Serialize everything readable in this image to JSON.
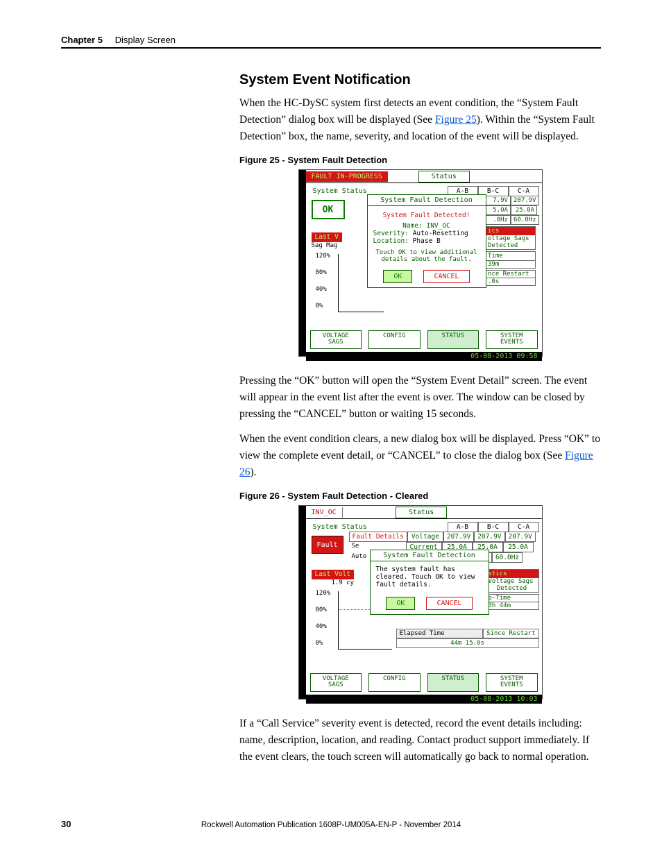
{
  "header": {
    "chapter": "Chapter 5",
    "section": "Display Screen"
  },
  "title": "System Event Notification",
  "para1_a": "When the HC-DySC system first detects an event condition, the “System Fault Detection” dialog box will be displayed (See ",
  "para1_link": "Figure 25",
  "para1_b": "). Within the “System Fault Detection” box, the name, severity, and location of the event will be displayed.",
  "fig25_cap": "Figure 25 - System Fault Detection",
  "fig25": {
    "title_tag": "FAULT IN-PROGRESS",
    "status_tab": "Status",
    "sys_status": "System Status",
    "cols": {
      "ab": "A-B",
      "bc": "B-C",
      "ca": "C-A"
    },
    "vals_ca_v": "207.9V",
    "vals_bc_v": "7.9V",
    "vals_bc_a": "5.0A",
    "vals_ca_a": "25.0A",
    "vals_bc_hz": ".0Hz",
    "vals_ca_hz": "60.0Hz",
    "ok": "OK",
    "last": "Last V",
    "sag": "Sag Mag",
    "y120": "120%",
    "y80": "80%",
    "y40": "40%",
    "y0": "0%",
    "dlg_title": "System Fault Detection",
    "dlg_detected": "System Fault Detected!",
    "dlg_name": "Name: INV_OC",
    "dlg_sev_lbl": "Severity: ",
    "dlg_sev_val": "Auto-Resetting",
    "dlg_loc_lbl": "Location: ",
    "dlg_loc_val": "Phase B",
    "dlg_hint1": "Touch OK to view additional",
    "dlg_hint2": "details about the fault.",
    "dlg_ok": "OK",
    "dlg_cancel": "CANCEL",
    "side_ics": "ics",
    "side_sags1": "oltage Sags",
    "side_sags2": "Detected",
    "side_time_h": "Time",
    "side_time_v": "39m",
    "side_restart_h": "nce Restart",
    "side_restart_v": ".0s",
    "nav_sags": "VOLTAGE\nSAGS",
    "nav_config": "CONFIG",
    "nav_status": "STATUS",
    "nav_events": "SYSTEM\nEVENTS",
    "timestamp": "05-08-2013 09:58"
  },
  "para2": "Pressing the “OK” button will open the “System Event Detail” screen. The event will appear in the event list after the event is over. The window can be closed by pressing the “CANCEL” button or waiting 15 seconds.",
  "para3_a": "When the event condition clears, a new dialog box will be displayed. Press “OK” to view the complete event detail, or “CANCEL” to close the dialog box (See ",
  "para3_link": "Figure 26",
  "para3_b": ").",
  "fig26_cap": "Figure 26 - System Fault Detection - Cleared",
  "fig26": {
    "title_tag": "INV_OC",
    "status_tab": "Status",
    "sys_status": "System Status",
    "cols": {
      "ab": "A-B",
      "bc": "B-C",
      "ca": "C-A"
    },
    "fault": "Fault",
    "fault_details": "Fault Details",
    "row_voltage": "Voltage",
    "row_current": "Current",
    "v_ab": "207.9V",
    "v_bc": "207.9V",
    "v_ca": "207.9V",
    "a_ab": "25.0A",
    "a_bc": "25.0A",
    "a_ca": "25.0A",
    "hz_bc": "60.0Hz",
    "hz_ca": "60.0Hz",
    "se": "Se",
    "auto": "Auto",
    "dlg_title": "System Fault Detection",
    "dlg_msg1": "The system fault has",
    "dlg_msg2": "cleared. Touch OK to view",
    "dlg_msg3": "fault details.",
    "dlg_ok": "OK",
    "dlg_cancel": "CANCEL",
    "last_volt": "Last Volt",
    "cyc": "1.9 cy",
    "y120": "120%",
    "y80": "80%",
    "y40": "40%",
    "y0": "0%",
    "side_stics": "stics",
    "side_sags1": "Voltage Sags",
    "side_sags2": "Detected",
    "side_up_h": "p-Time",
    "side_up_v": "3h 44m",
    "elapsed_lbl": "Elapsed Time",
    "since_restart": "Since Restart",
    "elapsed_val": "44m 15.0s",
    "nav_sags": "VOLTAGE\nSAGS",
    "nav_config": "CONFIG",
    "nav_status": "STATUS",
    "nav_events": "SYSTEM\nEVENTS",
    "timestamp": "05-08-2013 10:03"
  },
  "para4": "If a “Call Service” severity event is detected, record the event details including: name, description, location, and reading. Contact product support immediately. If the event clears, the touch screen will automatically go back to normal operation.",
  "page_number": "30",
  "publication": "Rockwell Automation Publication 1608P-UM005A-EN-P - November 2014"
}
